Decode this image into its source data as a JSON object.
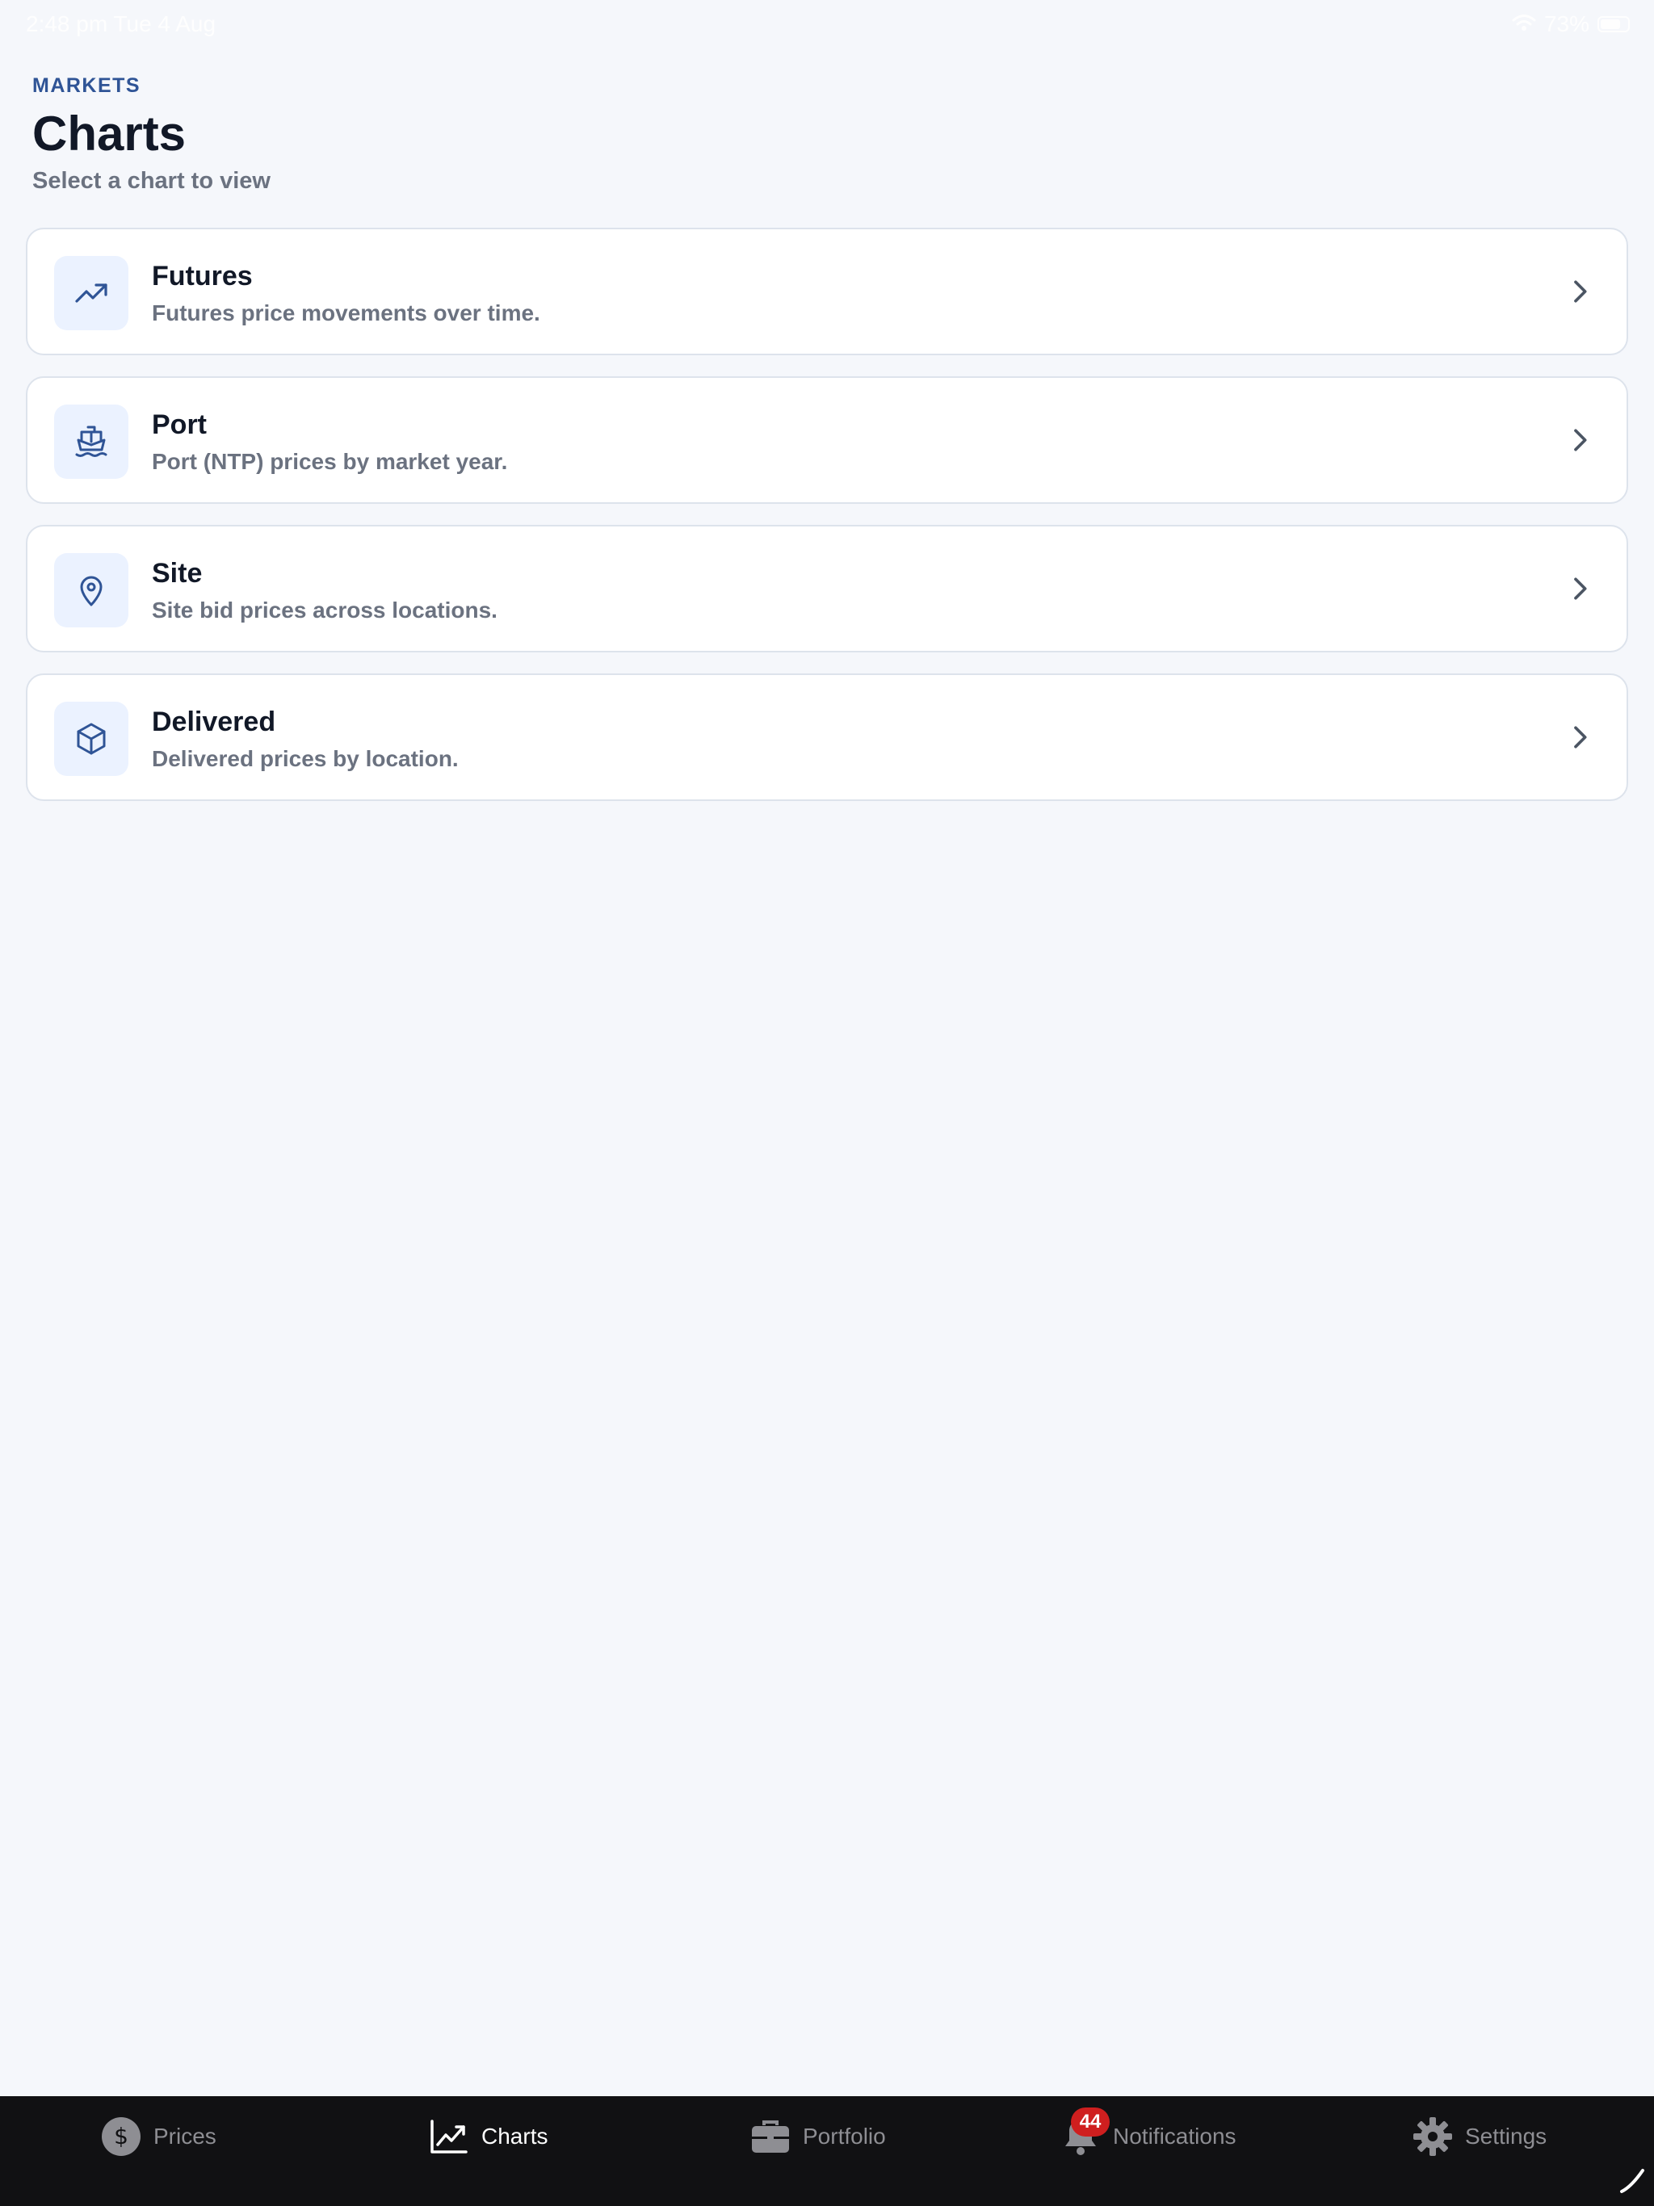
{
  "status_bar": {
    "time_date": "2:48 pm  Tue 4 Aug",
    "battery": "73%"
  },
  "header": {
    "eyebrow": "MARKETS",
    "title": "Charts",
    "subtitle": "Select a chart to view"
  },
  "cards": [
    {
      "icon": "trending-up-icon",
      "title": "Futures",
      "description": "Futures price movements over time."
    },
    {
      "icon": "ship-icon",
      "title": "Port",
      "description": "Port (NTP) prices by market year."
    },
    {
      "icon": "map-pin-icon",
      "title": "Site",
      "description": "Site bid prices across locations."
    },
    {
      "icon": "box-icon",
      "title": "Delivered",
      "description": "Delivered prices by location."
    }
  ],
  "tab_bar": {
    "tabs": [
      {
        "icon": "dollar-circle-icon",
        "label": "Prices",
        "active": false
      },
      {
        "icon": "chart-line-icon",
        "label": "Charts",
        "active": true
      },
      {
        "icon": "briefcase-icon",
        "label": "Portfolio",
        "active": false
      },
      {
        "icon": "bell-icon",
        "label": "Notifications",
        "active": false,
        "badge": "44"
      },
      {
        "icon": "gear-icon",
        "label": "Settings",
        "active": false
      }
    ]
  },
  "colors": {
    "accent": "#2f5496",
    "background": "#f5f7fb",
    "tab_bar": "#111113",
    "badge": "#cf1f1f"
  }
}
